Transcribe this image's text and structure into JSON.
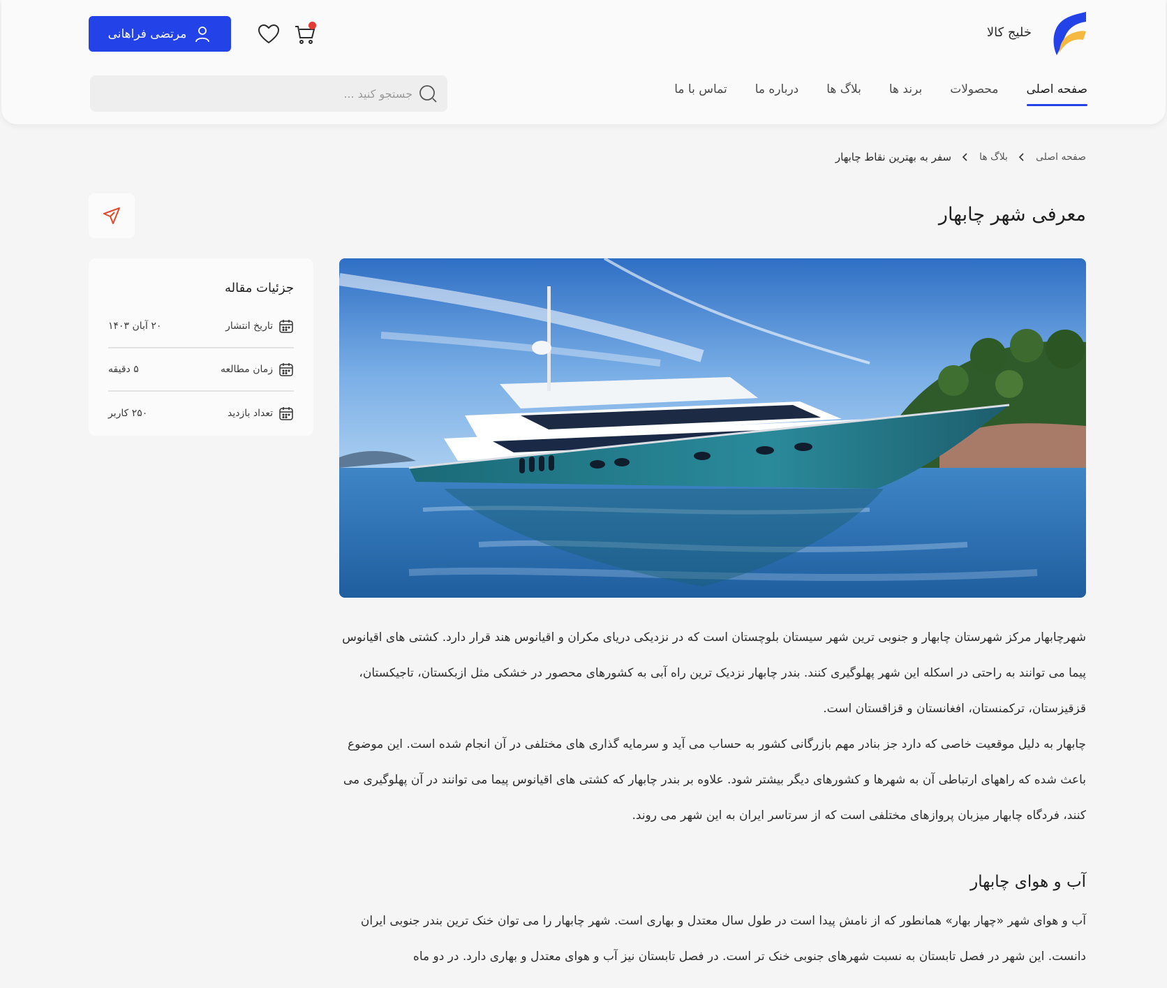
{
  "header": {
    "brand_name": "خلیج کالا",
    "user_button_label": "مرتضی فراهانی",
    "search_placeholder": "جستجو کنید ...",
    "nav": [
      {
        "label": "صفحه اصلی",
        "active": true
      },
      {
        "label": "محصولات"
      },
      {
        "label": "برند ها"
      },
      {
        "label": "بلاگ ها"
      },
      {
        "label": "درباره ما"
      },
      {
        "label": "تماس با ما"
      }
    ],
    "cart_has_items": true,
    "colors": {
      "accent": "#2342e8",
      "badge": "#e53935",
      "logo_blue": "#2342e8",
      "logo_yellow": "#f5b942"
    }
  },
  "breadcrumb": {
    "items": [
      "صفحه اصلی",
      "بلاگ ها",
      "سفر به بهترین نقاط چابهار"
    ]
  },
  "page_title": "معرفی شهر چابهار",
  "share_icon": "send-icon",
  "details": {
    "title": "جزئیات مقاله",
    "rows": [
      {
        "label": "تاریخ انتشار",
        "value": "۲۰ آبان ۱۴۰۳",
        "icon": "calendar-icon"
      },
      {
        "label": "زمان مطالعه",
        "value": "۵ دقیقه",
        "icon": "calendar-icon"
      },
      {
        "label": "تعداد بازدید",
        "value": "۲۵۰ کاربر",
        "icon": "calendar-icon"
      }
    ]
  },
  "hero_image": {
    "subject": "yacht-photo"
  },
  "article": {
    "paragraph1": "شهرچابهار مرکز شهرستان چابهار و جنوبی ترین شهر سیستان بلوچستان است که در نزدیکی دریای مکران و اقیانوس هند قرار دارد. کشتی های اقیانوس پیما می توانند به راحتی در اسکله این شهر پهلوگیری کنند. بندر چابهار نزدیک ترین راه آبی به کشورهای محصور در خشکی مثل ازبکستان، تاجیکستان، قزقیزستان، ترکمنستان، افغانستان و قزاقستان است.",
    "paragraph2": "چابهار به دلیل موقعیت خاصی که دارد جز بنادر مهم بازرگانی کشور به حساب می آید و سرمایه گذاری های مختلفی در آن انجام شده است. این موضوع باعث شده که راههای ارتباطی آن به شهرها و کشورهای دیگر بیشتر شود. علاوه بر بندر چابهار که کشتی های اقیانوس پیما می توانند در آن پهلوگیری می کنند، فردگاه چابهار میزبان پروازهای مختلفی است که از سرتاسر ایران به این شهر می روند.",
    "section_title": "آب و هوای چابهار",
    "paragraph3": "آب و هوای شهر «چهار بهار» همانطور که از نامش پیدا است در طول سال معتدل و بهاری است. شهر چابهار را می توان خنک ترین بندر جنوبی ایران دانست. این شهر در فصل تابستان به نسبت شهرهای جنوبی خنک تر است. در فصل تابستان نیز آب و هوای معتدل و بهاری دارد. در دو ماه"
  }
}
